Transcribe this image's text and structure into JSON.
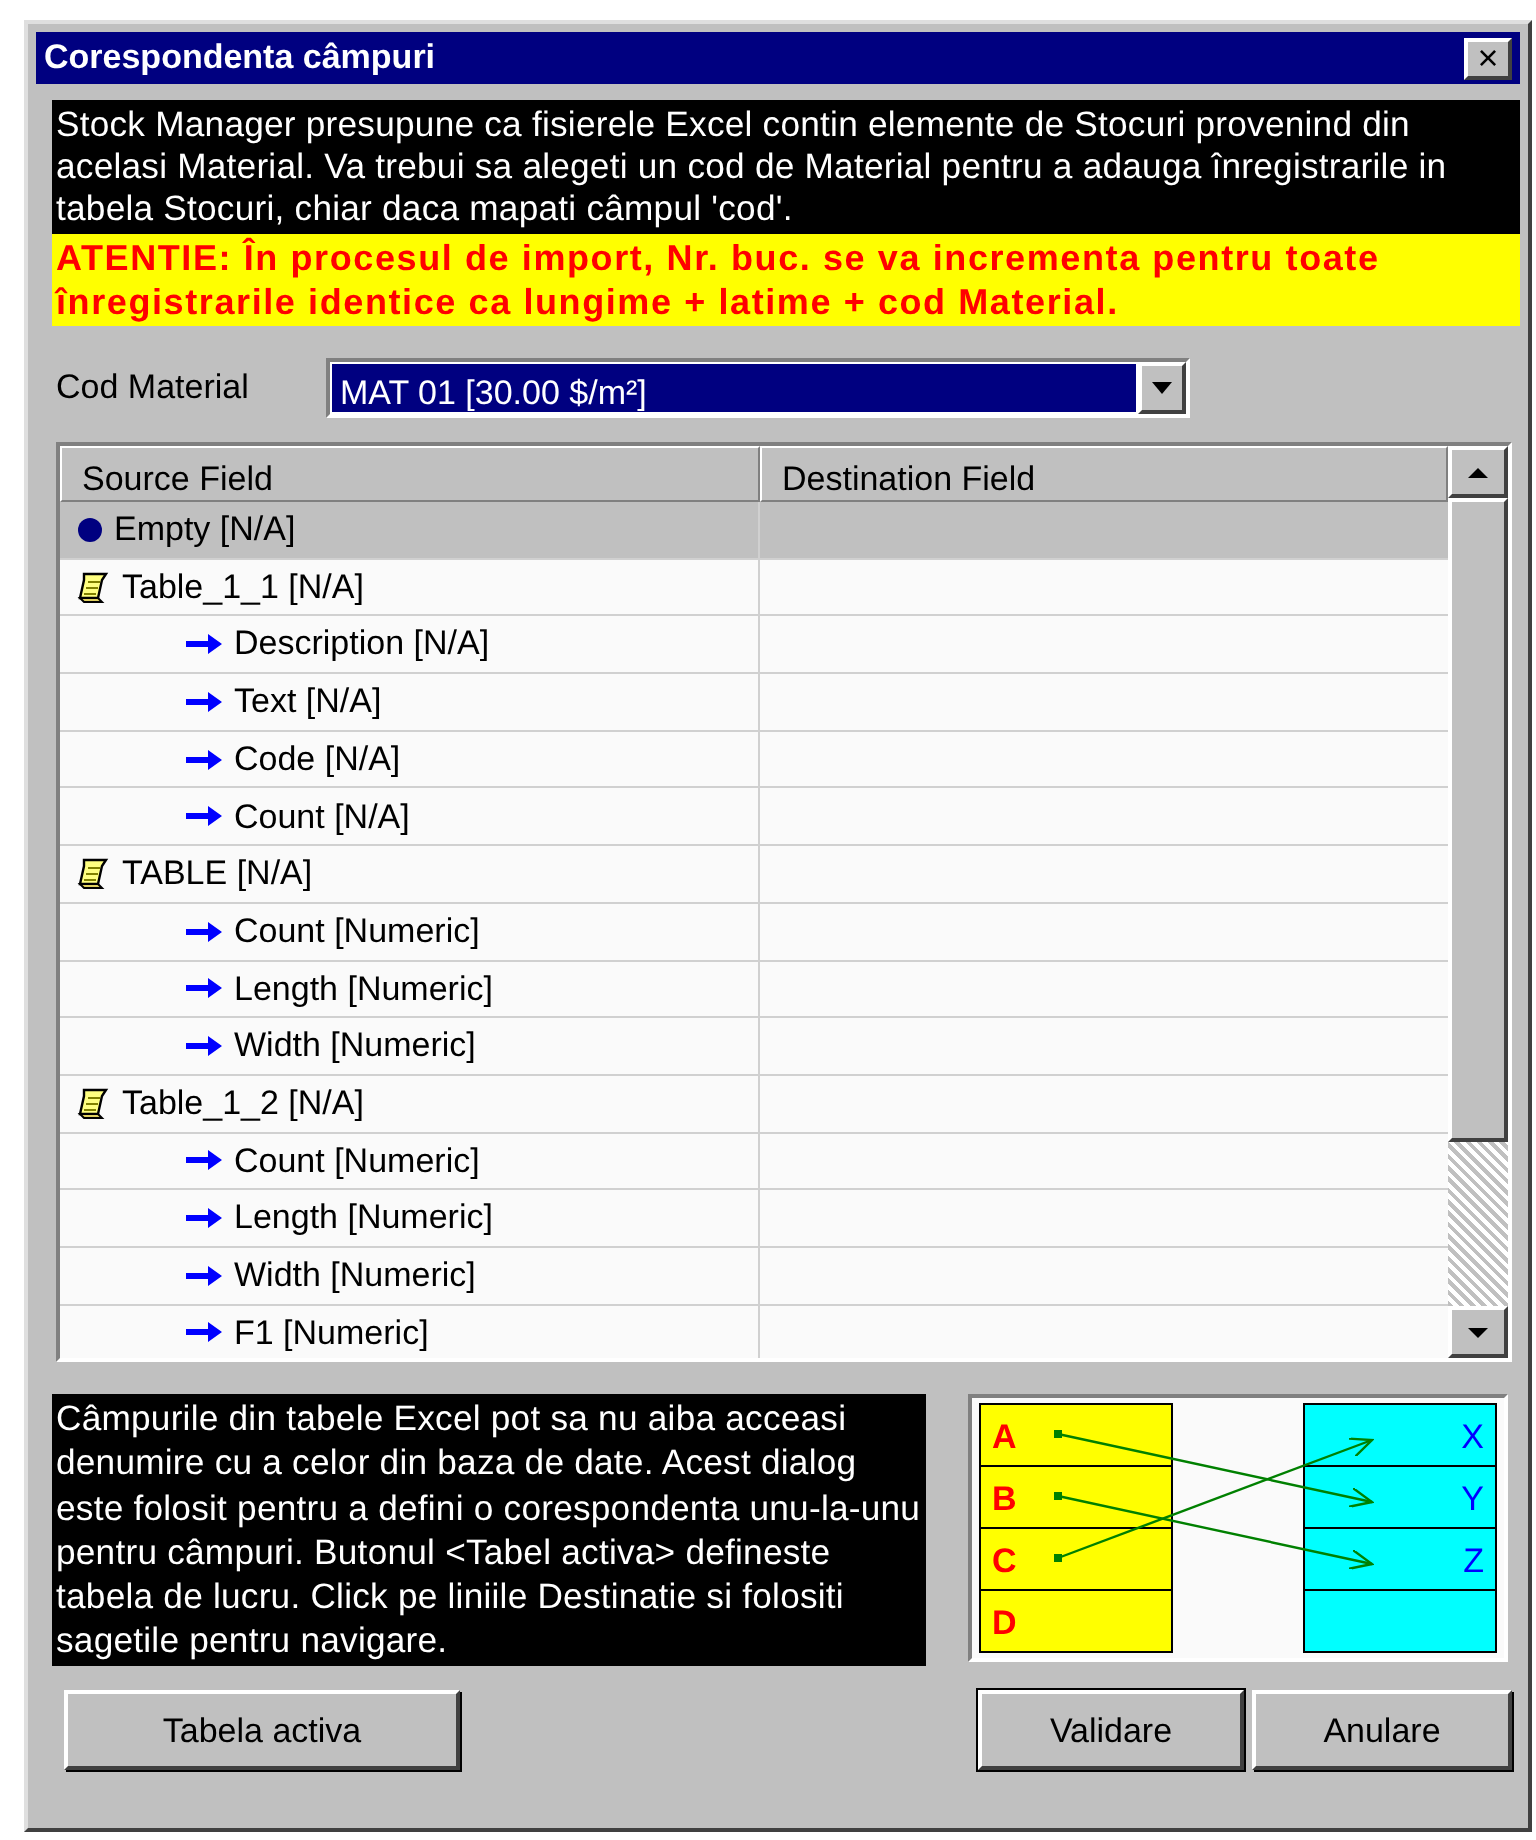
{
  "window": {
    "title": "Corespondenta câmpuri",
    "close": "×"
  },
  "info": {
    "text": "Stock Manager presupune ca fisierele Excel contin elemente de Stocuri provenind din acelasi Material. Va trebui sa alegeti un cod de Material pentru a adauga înregistrarile in tabela Stocuri, chiar daca mapati câmpul 'cod'.",
    "warning": "ATENTIE: În procesul de import, Nr. buc. se va incrementa pentru toate înregistrarile identice ca lungime + latime + cod Material."
  },
  "material": {
    "label": "Cod Material",
    "value": "MAT 01 [30.00 $/m²]"
  },
  "table": {
    "columns": [
      "Source Field",
      "Destination Field"
    ],
    "rows": [
      {
        "kind": "empty",
        "label": "Empty [N/A]",
        "selected": true
      },
      {
        "kind": "table",
        "label": "Table_1_1 [N/A]",
        "selected": false,
        "children": [
          {
            "kind": "field",
            "label": "Description [N/A]",
            "selected": false
          },
          {
            "kind": "field",
            "label": "Text [N/A]",
            "selected": false
          },
          {
            "kind": "field",
            "label": "Code [N/A]",
            "selected": false
          },
          {
            "kind": "field",
            "label": "Count [N/A]",
            "selected": false
          }
        ]
      },
      {
        "kind": "table",
        "label": "TABLE [N/A]",
        "selected": false,
        "children": [
          {
            "kind": "field",
            "label": "Count [Numeric]",
            "selected": false
          },
          {
            "kind": "field",
            "label": "Length [Numeric]",
            "selected": false
          },
          {
            "kind": "field",
            "label": "Width [Numeric]",
            "selected": false
          }
        ]
      },
      {
        "kind": "table",
        "label": "Table_1_2 [N/A]",
        "selected": false,
        "children": [
          {
            "kind": "field",
            "label": "Count [Numeric]",
            "selected": false
          },
          {
            "kind": "field",
            "label": "Length [Numeric]",
            "selected": false
          },
          {
            "kind": "field",
            "label": "Width [Numeric]",
            "selected": false
          },
          {
            "kind": "field",
            "label": "F1 [Numeric]",
            "selected": false
          }
        ]
      }
    ]
  },
  "help": "Câmpurile din tabele Excel pot sa nu aiba acceasi denumire cu a celor din baza de date. Acest dialog este folosit pentru a defini o corespondenta unu-la-unu pentru câmpuri. Butonul <Tabel activa> defineste tabela de lucru. Click pe liniile Destinatie si folositi sagetile pentru navigare.",
  "diagram": {
    "left": [
      "A",
      "B",
      "C",
      "D"
    ],
    "right": [
      "X",
      "Y",
      "Z"
    ]
  },
  "buttons": {
    "left": "Tabela activa",
    "right": [
      "Validare",
      "Anulare"
    ]
  }
}
